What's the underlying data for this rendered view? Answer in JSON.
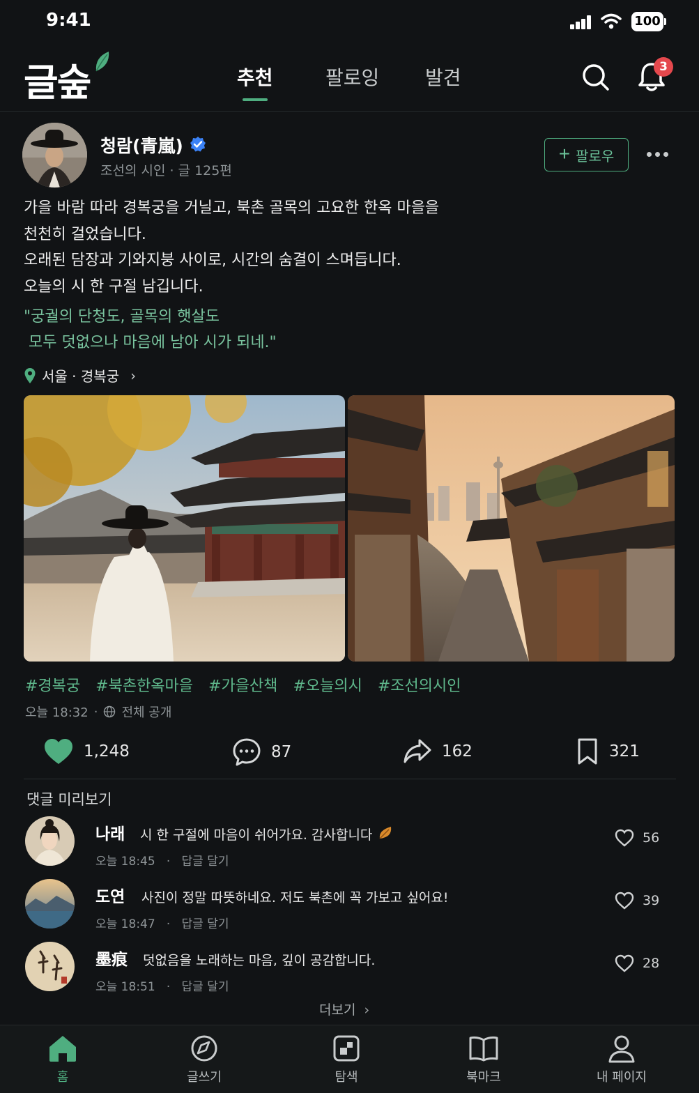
{
  "status_bar": {
    "time": "9:41",
    "battery": "100"
  },
  "header": {
    "logo": "글숲",
    "tabs": [
      {
        "label": "추천",
        "active": true
      },
      {
        "label": "팔로잉",
        "active": false
      },
      {
        "label": "발견",
        "active": false
      }
    ],
    "notification_count": "3"
  },
  "post": {
    "author": {
      "name": "청람(青嵐)",
      "meta": "조선의 시인 · 글 125편",
      "verified": true
    },
    "follow_label": "팔로우",
    "body_lines": [
      "가을 바람 따라 경복궁을 거닐고, 북촌 골목의 고요한 한옥 마을을",
      "천천히 걸었습니다.",
      "오래된 담장과 기와지붕 사이로, 시간의 숨결이 스며듭니다.",
      "오늘의 시 한 구절 남깁니다."
    ],
    "poem": "\"궁궐의 단청도, 골목의 햇살도\n 모두 덧없으나 마음에 남아 시가 되네.\"",
    "location": "서울 · 경복궁",
    "hashtags": [
      "#경복궁",
      "#북촌한옥마을",
      "#가을산책",
      "#오늘의시",
      "#조선의시인"
    ],
    "time": "오늘 18:32",
    "visibility": "전체 공개",
    "stats": {
      "likes": "1,248",
      "comments": "87",
      "shares": "162",
      "bookmarks": "321"
    }
  },
  "comments": {
    "title": "댓글 미리보기",
    "items": [
      {
        "author": "나래",
        "text": "시 한 구절에 마음이 쉬어가요. 감사합니다",
        "time": "오늘 18:45",
        "reply": "답글 달기",
        "likes": "56"
      },
      {
        "author": "도연",
        "text": "사진이 정말 따뜻하네요. 저도 북촌에 꼭 가보고 싶어요!",
        "time": "오늘 18:47",
        "reply": "답글 달기",
        "likes": "39"
      },
      {
        "author": "墨痕",
        "text": "덧없음을 노래하는 마음, 깊이 공감합니다.",
        "time": "오늘 18:51",
        "reply": "답글 달기",
        "likes": "28"
      }
    ],
    "more_label": "더보기"
  },
  "tab_bar": {
    "items": [
      {
        "label": "홈",
        "icon": "home-icon",
        "active": true
      },
      {
        "label": "글쓰기",
        "icon": "compass-icon",
        "active": false
      },
      {
        "label": "탐색",
        "icon": "explore-icon",
        "active": false
      },
      {
        "label": "북마크",
        "icon": "book-icon",
        "active": false
      },
      {
        "label": "내 페이지",
        "icon": "user-icon",
        "active": false
      }
    ]
  },
  "colors": {
    "accent": "#4fae80",
    "background": "#111315",
    "badge": "#e5484d"
  }
}
